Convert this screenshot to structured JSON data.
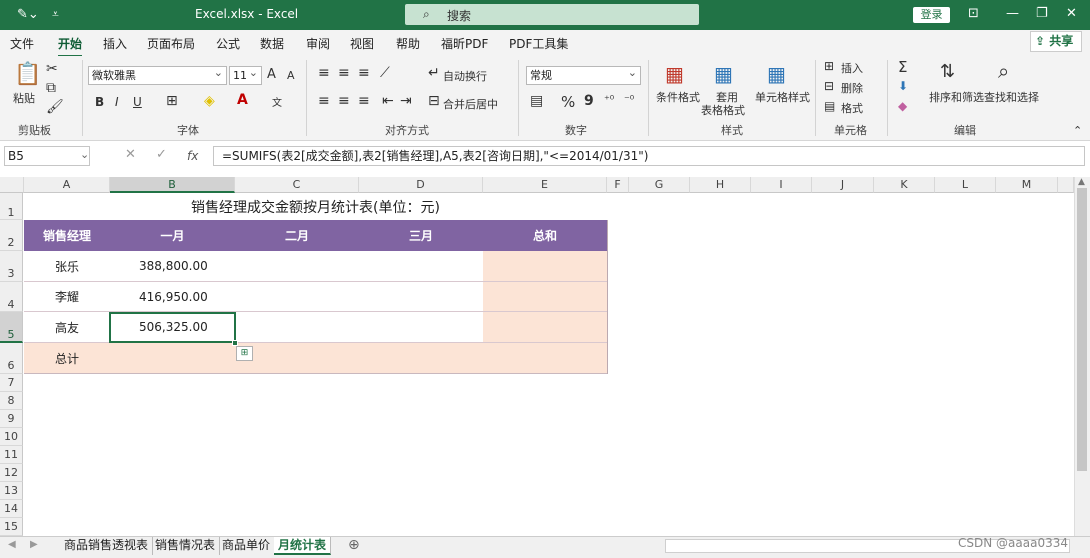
{
  "window": {
    "title": "Excel.xlsx  -  Excel",
    "search_placeholder": "搜索",
    "login": "登录"
  },
  "menu": [
    "文件",
    "开始",
    "插入",
    "页面布局",
    "公式",
    "数据",
    "审阅",
    "视图",
    "帮助",
    "福昕PDF",
    "PDF工具集"
  ],
  "share": "共享",
  "ribbon": {
    "clipboard": {
      "paste": "粘贴",
      "group": "剪贴板"
    },
    "font": {
      "name": "微软雅黑",
      "size": "11",
      "bold": "B",
      "italic": "I",
      "underline": "U",
      "group": "字体",
      "grow": "A",
      "shrink": "A"
    },
    "align": {
      "wrap": "自动换行",
      "merge": "合并后居中",
      "group": "对齐方式"
    },
    "number": {
      "format": "常规",
      "percent": "%",
      "comma": "9",
      "group": "数字"
    },
    "styles": {
      "cond": "条件格式",
      "table": "套用",
      "table2": "表格格式",
      "cell": "单元格样式",
      "group": "样式"
    },
    "cells": {
      "insert": "插入",
      "delete": "删除",
      "format": "格式",
      "group": "单元格"
    },
    "edit": {
      "sum": "Σ",
      "sort": "排序和筛选",
      "find": "查找和选择",
      "group": "编辑"
    }
  },
  "formula_bar": {
    "name_box": "B5",
    "fx": "fx",
    "formula": "=SUMIFS(表2[成交金额],表2[销售经理],A5,表2[咨询日期],\"<=2014/01/31\")"
  },
  "columns": [
    "A",
    "B",
    "C",
    "D",
    "E",
    "F",
    "G",
    "H",
    "I",
    "J",
    "K",
    "L",
    "M"
  ],
  "rows": [
    "1",
    "2",
    "3",
    "4",
    "5",
    "6",
    "7",
    "8",
    "9",
    "10",
    "11",
    "12",
    "13",
    "14",
    "15"
  ],
  "sheet": {
    "title": "销售经理成交金额按月统计表(单位：元)",
    "headers": [
      "销售经理",
      "一月",
      "二月",
      "三月",
      "总和"
    ],
    "data": [
      {
        "manager": "张乐",
        "jan": "388,800.00"
      },
      {
        "manager": "李耀",
        "jan": "416,950.00"
      },
      {
        "manager": "高友",
        "jan": "506,325.00"
      }
    ],
    "total_label": "总计"
  },
  "tabs": [
    "商品销售透视表",
    "销售情况表",
    "商品单价",
    "月统计表"
  ],
  "watermark": "CSDN @aaaa0334",
  "colors": {
    "excel_green": "#217346",
    "header_purple": "#8064a2",
    "peach": "#fce4d6"
  }
}
